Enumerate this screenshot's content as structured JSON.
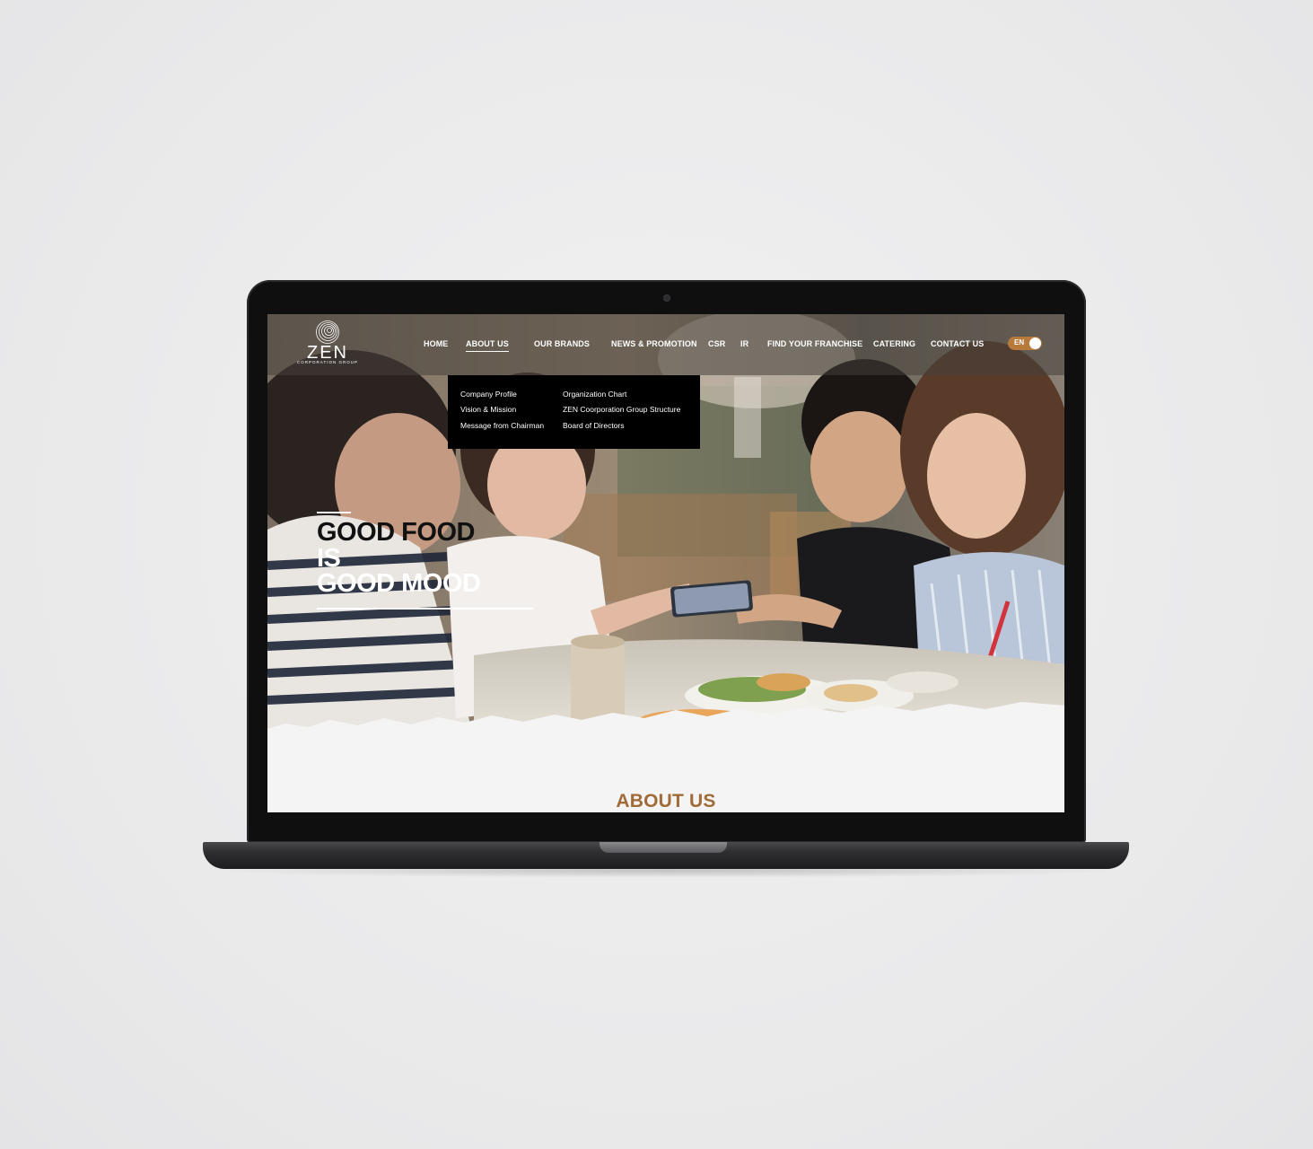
{
  "logo": {
    "name": "ZEN",
    "subtitle": "CORPORATION GROUP"
  },
  "nav": {
    "items": [
      {
        "label": "HOME"
      },
      {
        "label": "ABOUT US",
        "active": true
      },
      {
        "label": "OUR BRANDS"
      },
      {
        "label": "NEWS & PROMOTION"
      },
      {
        "label": "CSR"
      },
      {
        "label": "IR"
      },
      {
        "label": "FIND YOUR FRANCHISE"
      },
      {
        "label": "CATERING"
      },
      {
        "label": "CONTACT US"
      }
    ],
    "language": "EN"
  },
  "dropdown": {
    "left_column": [
      "Company Profile",
      "Vision & Mission",
      "Message from Chairman"
    ],
    "right_column": [
      "Organization Chart",
      "ZEN Coorporation Group Structure",
      "Board of Directors"
    ]
  },
  "hero": {
    "tagline": [
      "GOOD FOOD",
      "IS",
      "GOOD MOOD"
    ]
  },
  "section": {
    "title": "ABOUT US"
  },
  "colors": {
    "accent": "#a06b36",
    "toggle": "#b77a3a",
    "dropdown_bg": "#000000",
    "section_bg": "#f4f4f4"
  }
}
